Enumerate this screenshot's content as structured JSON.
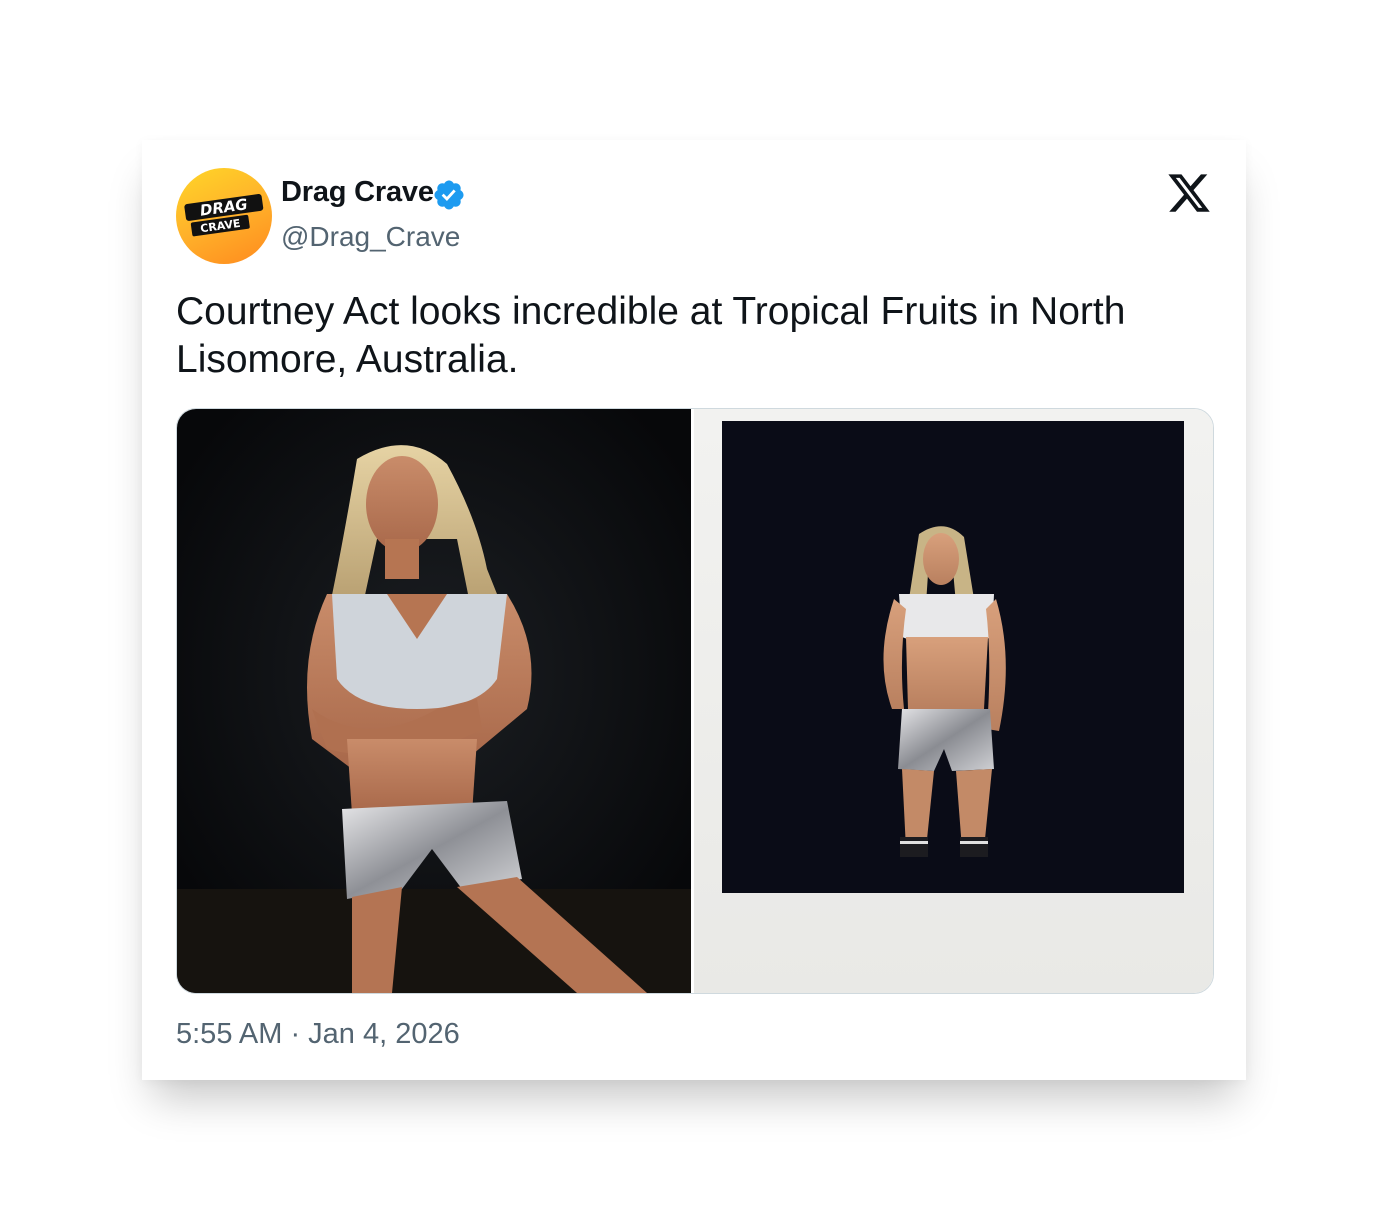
{
  "author": {
    "display_name": "Drag Crave",
    "handle": "@Drag_Crave",
    "verified": true,
    "avatar_text_top": "DRAG",
    "avatar_text_bottom": "CRAVE"
  },
  "tweet": {
    "text": "Courtney Act looks incredible at Tropical Fruits in North Lisomore, Australia.",
    "timestamp": "5:55 AM · Jan 4, 2026"
  },
  "media": {
    "count": 2,
    "images": [
      "photo-night-pose",
      "polaroid-photo"
    ]
  },
  "icons": {
    "platform": "x-logo-icon",
    "verified": "verified-badge-icon"
  },
  "colors": {
    "text_primary": "#0f1419",
    "text_secondary": "#536471",
    "verified_blue": "#1d9bf0",
    "avatar_orange": "#ffb22a"
  }
}
